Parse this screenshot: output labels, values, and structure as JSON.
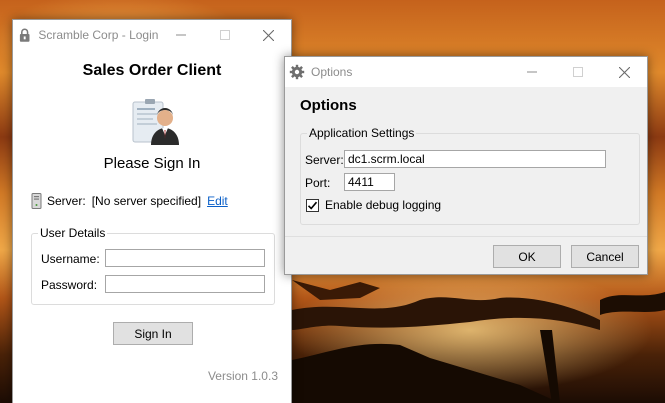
{
  "login_window": {
    "title": "Scramble Corp - Login",
    "heading": "Sales Order Client",
    "sign_in_title": "Please Sign In",
    "server_label": "Server:",
    "server_value": "[No server specified]",
    "edit_link": "Edit",
    "user_details_group": "User Details",
    "username_label": "Username:",
    "username_value": "",
    "password_label": "Password:",
    "password_value": "",
    "sign_in_button": "Sign In",
    "version": "Version 1.0.3"
  },
  "options_window": {
    "title": "Options",
    "heading": "Options",
    "settings_group": "Application Settings",
    "server_label": "Server:",
    "server_value": "dc1.scrm.local",
    "port_label": "Port:",
    "port_value": "4411",
    "debug_checkbox_label": "Enable debug logging",
    "debug_checked": true,
    "ok_button": "OK",
    "cancel_button": "Cancel"
  },
  "colors": {
    "link": "#0a5fc8",
    "button_face": "#e1e1e1",
    "dialog_background": "#f0f0f0",
    "title_text": "#8c8c8c"
  },
  "icons": {
    "login_title_icon": "padlock-icon",
    "options_title_icon": "gear-icon",
    "server_icon": "server-tower-icon",
    "user_image": "user-portrait-icon",
    "minimize": "minimize-icon",
    "maximize": "maximize-icon",
    "close": "close-icon",
    "checkbox": "checkmark-icon"
  }
}
